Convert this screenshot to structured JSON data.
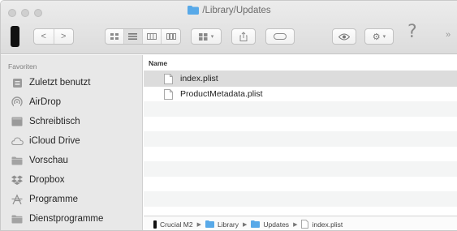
{
  "window": {
    "title": "/Library/Updates"
  },
  "toolbar": {
    "back_label": "<",
    "forward_label": ">",
    "help_label": "?",
    "more_label": "»"
  },
  "sidebar": {
    "heading": "Favoriten",
    "items": [
      {
        "label": "Zuletzt benutzt",
        "icon": "recents-icon"
      },
      {
        "label": "AirDrop",
        "icon": "airdrop-icon"
      },
      {
        "label": "Schreibtisch",
        "icon": "desktop-icon"
      },
      {
        "label": "iCloud Drive",
        "icon": "cloud-icon"
      },
      {
        "label": "Vorschau",
        "icon": "folder-icon"
      },
      {
        "label": "Dropbox",
        "icon": "dropbox-icon"
      },
      {
        "label": "Programme",
        "icon": "applications-icon"
      },
      {
        "label": "Dienstprogramme",
        "icon": "folder-icon"
      }
    ]
  },
  "file_list": {
    "column_name": "Name",
    "files": [
      {
        "name": "index.plist",
        "selected": true
      },
      {
        "name": "ProductMetadata.plist",
        "selected": false
      }
    ]
  },
  "pathbar": {
    "crumbs": [
      "Crucial M2",
      "Library",
      "Updates",
      "index.plist"
    ]
  },
  "colors": {
    "folder_blue": "#58a9e8",
    "sidebar_bg": "#e8e8e8",
    "selected_row": "#dcdcdc"
  }
}
